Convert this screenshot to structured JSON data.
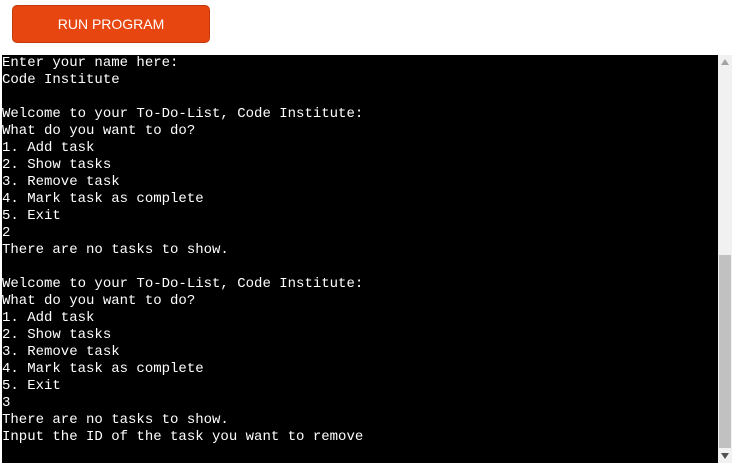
{
  "toolbar": {
    "run_label": "RUN PROGRAM",
    "run_color": "#e84610"
  },
  "terminal": {
    "background": "#000000",
    "text_color": "#ffffff",
    "lines": [
      "Enter your name here:",
      "Code Institute",
      "",
      "Welcome to your To-Do-List, Code Institute:",
      "What do you want to do?",
      "1. Add task",
      "2. Show tasks",
      "3. Remove task",
      "4. Mark task as complete",
      "5. Exit",
      "2",
      "There are no tasks to show.",
      "",
      "Welcome to your To-Do-List, Code Institute:",
      "What do you want to do?",
      "1. Add task",
      "2. Show tasks",
      "3. Remove task",
      "4. Mark task as complete",
      "5. Exit",
      "3",
      "There are no tasks to show.",
      "Input the ID of the task you want to remove"
    ]
  },
  "scrollbar": {
    "up_icon": "triangle-up",
    "down_icon": "triangle-down",
    "scroll_position": 0.55
  }
}
